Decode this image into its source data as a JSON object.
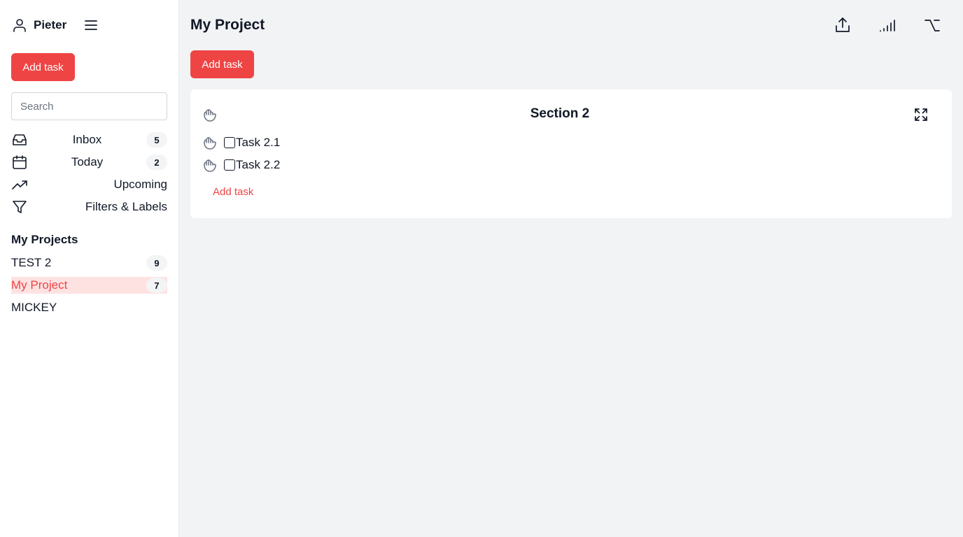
{
  "sidebar": {
    "user_name": "Pieter",
    "add_task_label": "Add task",
    "search_placeholder": "Search",
    "nav": [
      {
        "label": "Inbox",
        "count": "5",
        "icon": "inbox-icon"
      },
      {
        "label": "Today",
        "count": "2",
        "icon": "calendar-icon"
      },
      {
        "label": "Upcoming",
        "icon": "trending-up-icon"
      },
      {
        "label": "Filters & Labels",
        "icon": "filter-icon"
      }
    ],
    "projects_title": "My Projects",
    "projects": [
      {
        "label": "TEST 2",
        "count": "9"
      },
      {
        "label": "My Project",
        "count": "7",
        "active": true
      },
      {
        "label": "MICKEY"
      }
    ]
  },
  "main": {
    "title": "My Project",
    "add_task_label": "Add task",
    "toolbar_icons": [
      "share-icon",
      "signal-icon",
      "option-icon"
    ],
    "section": {
      "title": "Section 2",
      "tasks": [
        {
          "label": "Task 2.1",
          "checked": false
        },
        {
          "label": "Task 2.2",
          "checked": false
        }
      ],
      "add_task_label": "Add task"
    }
  },
  "colors": {
    "accent": "#ef4444",
    "active_bg": "#fee2e2",
    "main_bg": "#f2f3f5"
  }
}
